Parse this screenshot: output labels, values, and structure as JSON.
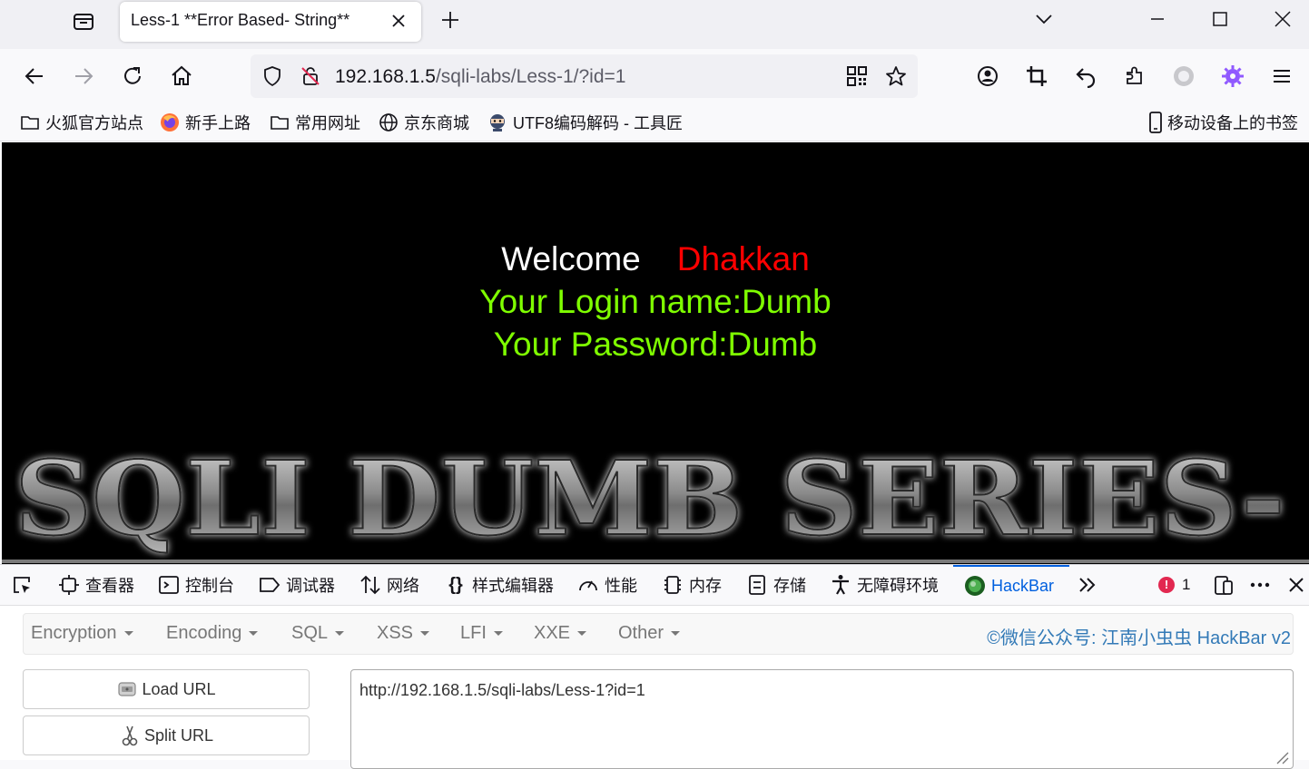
{
  "browser": {
    "tab": {
      "title": "Less-1 **Error Based- String**"
    },
    "url": {
      "host": "192.168.1.5",
      "path": "/sqli-labs/Less-1/?id=1"
    },
    "bookmarks": [
      {
        "label": "火狐官方站点",
        "icon": "folder-icon"
      },
      {
        "label": "新手上路",
        "icon": "firefox-icon"
      },
      {
        "label": "常用网址",
        "icon": "folder-icon"
      },
      {
        "label": "京东商城",
        "icon": "globe-icon"
      },
      {
        "label": "UTF8编码解码 - 工具匠",
        "icon": "ninja-icon"
      }
    ],
    "mobile_bookmarks": "移动设备上的书签"
  },
  "page": {
    "welcome": "Welcome",
    "name": "Dhakkan",
    "login_line": "Your Login name:Dumb",
    "password_line": "Your Password:Dumb",
    "banner": "SQLI DUMB SERIES-",
    "colors": {
      "background": "#000000",
      "welcome": "#ffffff",
      "name": "#ff0000",
      "info": "#7fff00"
    }
  },
  "devtools": {
    "tabs": [
      {
        "label": "查看器",
        "icon": "inspector-icon"
      },
      {
        "label": "控制台",
        "icon": "console-icon"
      },
      {
        "label": "调试器",
        "icon": "debugger-icon"
      },
      {
        "label": "网络",
        "icon": "network-icon"
      },
      {
        "label": "样式编辑器",
        "icon": "style-editor-icon"
      },
      {
        "label": "性能",
        "icon": "performance-icon"
      },
      {
        "label": "内存",
        "icon": "memory-icon"
      },
      {
        "label": "存储",
        "icon": "storage-icon"
      },
      {
        "label": "无障碍环境",
        "icon": "accessibility-icon"
      },
      {
        "label": "HackBar",
        "icon": "hackbar-icon",
        "active": true
      }
    ],
    "error_count": "1"
  },
  "hackbar": {
    "menu": [
      "Encryption",
      "Encoding",
      "SQL",
      "XSS",
      "LFI",
      "XXE",
      "Other"
    ],
    "credit": "©微信公众号: 江南小虫虫 HackBar v2",
    "load_url": "Load URL",
    "split_url": "Split URL",
    "url_value": "http://192.168.1.5/sqli-labs/Less-1?id=1"
  }
}
